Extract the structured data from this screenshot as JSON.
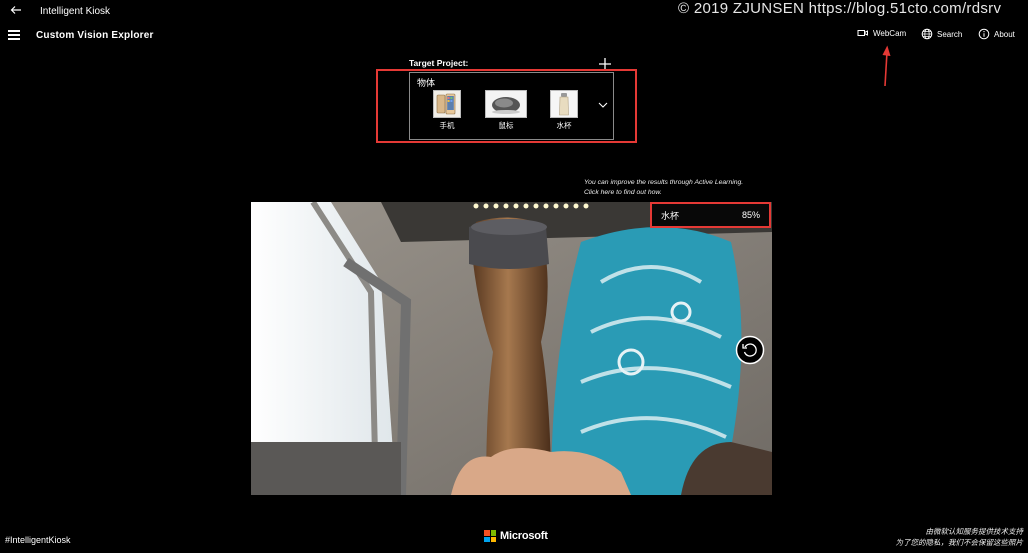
{
  "window": {
    "app_title": "Intelligent Kiosk",
    "watermark": "© 2019 ZJUNSEN https://blog.51cto.com/rdsrv"
  },
  "header": {
    "page_title": "Custom Vision Explorer",
    "nav": [
      {
        "label": "WebCam",
        "icon": "video-camera-icon"
      },
      {
        "label": "Search",
        "icon": "globe-icon"
      },
      {
        "label": "About",
        "icon": "info-icon"
      }
    ]
  },
  "project": {
    "label": "Target Project:",
    "name": "物体",
    "tags": [
      {
        "label": "手机",
        "icon": "phone-thumbnail"
      },
      {
        "label": "鼠标",
        "icon": "mouse-thumbnail"
      },
      {
        "label": "水杯",
        "icon": "cup-thumbnail"
      }
    ]
  },
  "hint": {
    "line1": "You can improve the results through Active Learning.",
    "line2": "Click here to find out how."
  },
  "result": {
    "tag": "水杯",
    "confidence": "85%"
  },
  "footer": {
    "hashtag": "#IntelligentKiosk",
    "brand": "Microsoft",
    "note_line1": "由微软认知服务提供技术支持",
    "note_line2": "为了您的隐私，我们不会保留这些照片"
  },
  "colors": {
    "background": "#000000",
    "highlight_red": "#e53935",
    "text": "#ffffff"
  }
}
